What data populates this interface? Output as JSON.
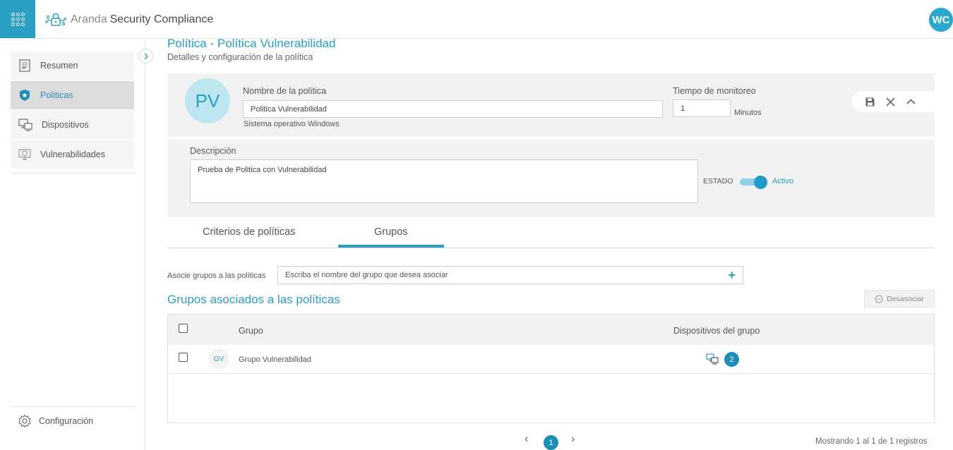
{
  "header": {
    "brand_part1": "Aranda",
    "brand_part2": "Security Compliance",
    "user_initials": "WC"
  },
  "sidebar": {
    "items": [
      {
        "label": "Resumen",
        "icon": "summary-icon"
      },
      {
        "label": "Politicas",
        "icon": "shield-star-icon",
        "active": true
      },
      {
        "label": "Dispositivos",
        "icon": "devices-icon"
      },
      {
        "label": "Vulnerabilidades",
        "icon": "vulnerability-icon"
      }
    ],
    "config_label": "Configuración"
  },
  "page": {
    "title": "Política - Política Vulnerabilidad",
    "subtitle": "Detalles y configuración de la política"
  },
  "policy": {
    "initials": "PV",
    "name_label": "Nombre de la política",
    "name_value": "Politica Vulnerabilidad",
    "os_text": "Sistema operativo Windows",
    "monitor_label": "Tiempo de monitoreo",
    "monitor_value": "1",
    "monitor_unit": "Minutos",
    "description_label": "Descripción",
    "description_value": "Prueba de Politica con Vulnerabilidad",
    "status_label": "ESTADO",
    "status_value": "Activo"
  },
  "tabs": [
    {
      "label": "Criterios de políticas"
    },
    {
      "label": "Grupos",
      "active": true
    }
  ],
  "associate": {
    "label": "Asocie grupos a las políticas",
    "placeholder": "Escriba el nombre del grupo que desea asociar",
    "add_symbol": "+"
  },
  "groups_section": {
    "title": "Grupos asociados a las políticas",
    "disassociate_label": "Desasociar"
  },
  "table": {
    "columns": [
      "Grupo",
      "Dispositivos del grupo"
    ],
    "rows": [
      {
        "initials": "GV",
        "name": "Grupo Vulnerabilidad",
        "devices": "2"
      }
    ]
  },
  "pagination": {
    "prev": "‹",
    "current": "1",
    "next": "›",
    "showing": "Mostrando 1 al 1 de 1 registros"
  },
  "colors": {
    "accent": "#2a9fc3",
    "badge": "#1d8eb5",
    "panel": "#f2f2f2"
  }
}
